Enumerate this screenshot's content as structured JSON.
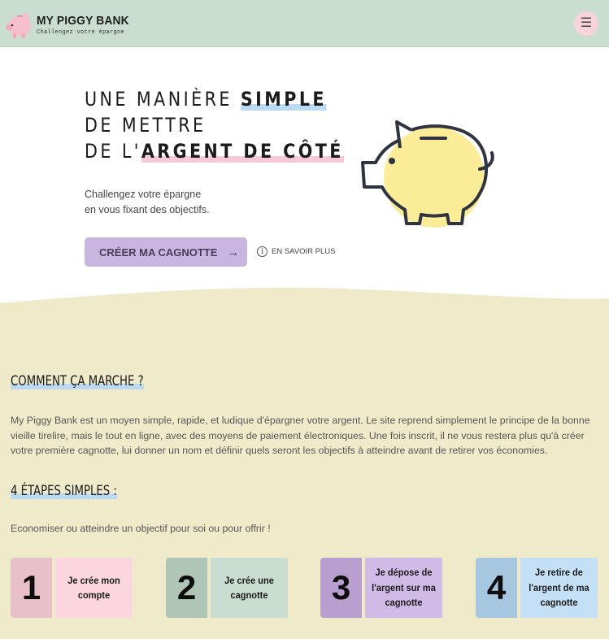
{
  "header": {
    "brand_title": "MY PIGGY BANK",
    "brand_subtitle": "Challengez votre épargne",
    "menu_icon": "hamburger-icon",
    "menu_glyph": "☰"
  },
  "hero": {
    "line1_plain": "UNE MANIÈRE ",
    "line1_highlight": "SIMPLE",
    "line2": "DE METTRE",
    "line3_plain": "DE L'",
    "line3_highlight": "ARGENT DE CÔTÉ",
    "desc_line1": "Challengez votre épargne",
    "desc_line2": "en vous fixant des objectifs.",
    "cta_label": "CRÉER MA CAGNOTTE",
    "cta_arrow": "→",
    "learn_icon_glyph": "i",
    "learn_label": "EN SAVOIR PLUS"
  },
  "how": {
    "title": "COMMENT ÇA MARCHE ?",
    "text": "My Piggy Bank est un moyen simple, rapide, et ludique d'épargner votre argent. Le site reprend simplement le principe de la bonne vieille tirelire, mais le tout en ligne, avec des moyens de paiement électroniques. Une fois inscrit, il ne vous restera plus qu'à créer votre première cagnotte, lui donner un nom et définir quels seront les objectifs à atteindre avant de retirer vos économies."
  },
  "steps": {
    "title": "4 ÉTAPES SIMPLES :",
    "subtitle": "Economiser ou atteindre un objectif pour soi ou pour offrir !",
    "items": [
      {
        "number": "1",
        "label": "Je crée mon compte"
      },
      {
        "number": "2",
        "label": "Je crée une cagnotte"
      },
      {
        "number": "3",
        "label": "Je dépose de l'argent sur ma cagnotte"
      },
      {
        "number": "4",
        "label": "Je retire de l'argent de ma cagnotte"
      }
    ]
  },
  "colors": {
    "header_bg": "#c9ddd0",
    "section_bg": "#efebca",
    "cta_bg": "#c8b5e0",
    "pig_fill": "#fbec98",
    "step1": [
      "#e7c0c9",
      "#fbd6de"
    ],
    "step2": [
      "#afc5b6",
      "#c9ddd0"
    ],
    "step3": [
      "#b89fd0",
      "#d0bbe6"
    ],
    "step4": [
      "#a7c6e0",
      "#c3e0f6"
    ]
  }
}
